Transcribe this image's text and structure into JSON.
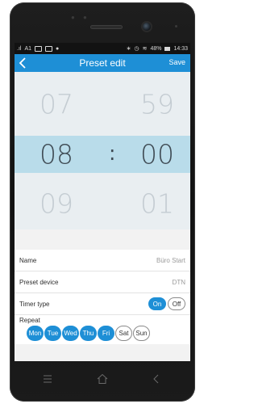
{
  "statusbar": {
    "carrier": "A1",
    "battery": "48%",
    "time": "14:33"
  },
  "header": {
    "title": "Preset edit",
    "save_label": "Save"
  },
  "picker": {
    "hour_prev": "07",
    "hour_selected": "08",
    "hour_next": "09",
    "minute_prev": "59",
    "minute_selected": "00",
    "minute_next": "01",
    "separator": ":"
  },
  "form": {
    "name_label": "Name",
    "name_value": "Büro Start",
    "device_label": "Preset device",
    "device_value": "DTN",
    "timer_label": "Timer type",
    "timer_on": "On",
    "timer_off": "Off",
    "timer_state": "On",
    "repeat_label": "Repeat"
  },
  "days": [
    {
      "label": "Mon",
      "selected": true
    },
    {
      "label": "Tue",
      "selected": true
    },
    {
      "label": "Wed",
      "selected": true
    },
    {
      "label": "Thu",
      "selected": true
    },
    {
      "label": "Fri",
      "selected": true
    },
    {
      "label": "Sat",
      "selected": false
    },
    {
      "label": "Sun",
      "selected": false
    }
  ],
  "colors": {
    "accent": "#1e8fd6",
    "picker_highlight": "#b9dcea",
    "picker_bg": "#e9eef1"
  },
  "icons": {
    "back": "chevron-left-icon",
    "nav_menu": "menu-icon",
    "nav_home": "home-icon",
    "nav_back": "back-icon"
  }
}
